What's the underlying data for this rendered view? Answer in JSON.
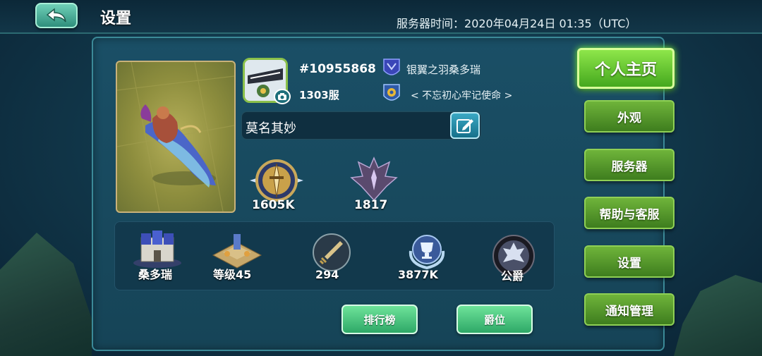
{
  "header": {
    "title": "设置",
    "server_time_label": "服务器时间：",
    "server_time_value": "2020年04月24日 01:35（UTC）"
  },
  "profile": {
    "player_id": "#10955868",
    "server": "1303服",
    "guild_name": "银翼之羽桑多瑞",
    "motto": "< 不忘初心牢记使命 >",
    "nickname": "莫名其妙",
    "power": "1605K",
    "kills": "1817"
  },
  "stats": {
    "civilization": "桑多瑞",
    "level": "等级45",
    "attack": "294",
    "honor": "3877K",
    "rank_title": "公爵"
  },
  "buttons": {
    "leaderboard": "排行榜",
    "title": "爵位"
  },
  "sidebar": {
    "items": [
      {
        "label": "个人主页",
        "active": true
      },
      {
        "label": "外观",
        "active": false
      },
      {
        "label": "服务器",
        "active": false
      },
      {
        "label": "帮助与客服",
        "active": false
      },
      {
        "label": "设置",
        "active": false
      },
      {
        "label": "通知管理",
        "active": false
      }
    ]
  },
  "colors": {
    "accent_green": "#6fb43a",
    "button_green": "#2ea867",
    "panel": "#1a4f66",
    "frame_gold": "#c9b27a"
  }
}
